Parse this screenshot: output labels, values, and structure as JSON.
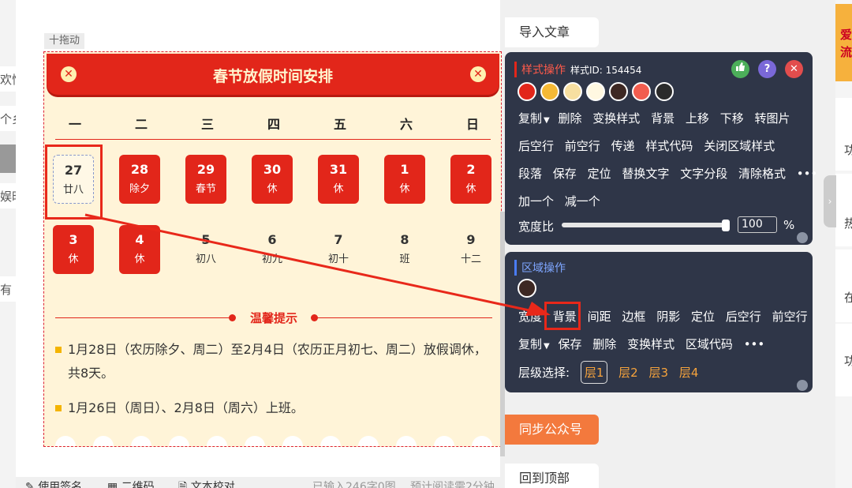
{
  "left_strip": {
    "items": [
      "欢愉",
      "个乡",
      "娱时",
      "有"
    ]
  },
  "editor": {
    "drag_label": "十拖动",
    "card": {
      "title": "春节放假时间安排",
      "close_symbol": "✕",
      "weekdays": [
        "一",
        "二",
        "三",
        "四",
        "五",
        "六",
        "日"
      ],
      "week1": [
        {
          "num": "27",
          "sub": "廿八",
          "style": "selected"
        },
        {
          "num": "28",
          "sub": "除夕",
          "style": "red"
        },
        {
          "num": "29",
          "sub": "春节",
          "style": "red"
        },
        {
          "num": "30",
          "sub": "休",
          "style": "red"
        },
        {
          "num": "31",
          "sub": "休",
          "style": "red"
        },
        {
          "num": "1",
          "sub": "休",
          "style": "red"
        },
        {
          "num": "2",
          "sub": "休",
          "style": "red"
        }
      ],
      "week2": [
        {
          "num": "3",
          "sub": "休",
          "style": "red"
        },
        {
          "num": "4",
          "sub": "休",
          "style": "red"
        },
        {
          "num": "5",
          "sub": "初八",
          "style": "plain"
        },
        {
          "num": "6",
          "sub": "初九",
          "style": "plain"
        },
        {
          "num": "7",
          "sub": "初十",
          "style": "plain"
        },
        {
          "num": "8",
          "sub": "班",
          "style": "plain"
        },
        {
          "num": "9",
          "sub": "十二",
          "style": "plain"
        }
      ],
      "tip_title": "温馨提示",
      "notes": [
        "1月28日（农历除夕、周二）至2月4日（农历正月初七、周二）放假调休，共8天。",
        "1月26日（周日）、2月8日（周六）上班。"
      ]
    },
    "footer": [
      "使用签名",
      "二维码",
      "文本校对",
      "已输入246字0图",
      "预计阅读需2分钟"
    ]
  },
  "mid_buttons": {
    "import": "导入文章",
    "sync": "同步公众号",
    "top": "回到顶部"
  },
  "style_popup": {
    "title": "样式操作",
    "id_label": "样式ID: 154454",
    "help_symbol": "?",
    "close_symbol": "✕",
    "swatches": [
      "#e2261a",
      "#f5b935",
      "#f7dfa0",
      "#fff8e1",
      "#3d2823",
      "#f25d4f",
      "#2b2b2b"
    ],
    "row1": [
      "复制",
      "删除",
      "变换样式",
      "背景",
      "上移",
      "下移",
      "转图片"
    ],
    "row1_dropdown": "▼",
    "row2": [
      "后空行",
      "前空行",
      "传递",
      "样式代码",
      "关闭区域样式"
    ],
    "row3": [
      "段落",
      "保存",
      "定位",
      "替换文字",
      "文字分段",
      "清除格式",
      "•••"
    ],
    "row4": [
      "加一个",
      "减一个"
    ],
    "width_label": "宽度比",
    "width_value": "100",
    "width_unit": "%",
    "width_ratio": 1.0
  },
  "region_popup": {
    "title": "区域操作",
    "swatch": "#3d2823",
    "row1": [
      "宽度",
      "背景",
      "间距",
      "边框",
      "阴影",
      "定位",
      "后空行",
      "前空行"
    ],
    "row2": [
      "复制",
      "保存",
      "删除",
      "变换样式",
      "区域代码",
      "•••"
    ],
    "row2_dropdown": "▼",
    "layer_label": "层级选择:",
    "layers": [
      "层1",
      "层2",
      "层3",
      "层4"
    ]
  },
  "right_panel": {
    "thumb_text": "爱 流",
    "cards": [
      "功",
      "热",
      "在",
      "功"
    ],
    "tab_symbol": "›"
  },
  "colors": {
    "accent_red": "#e2261a",
    "card_bg": "#fff4d8",
    "popup_bg": "#2f3648",
    "sync_orange": "#f3793d"
  }
}
